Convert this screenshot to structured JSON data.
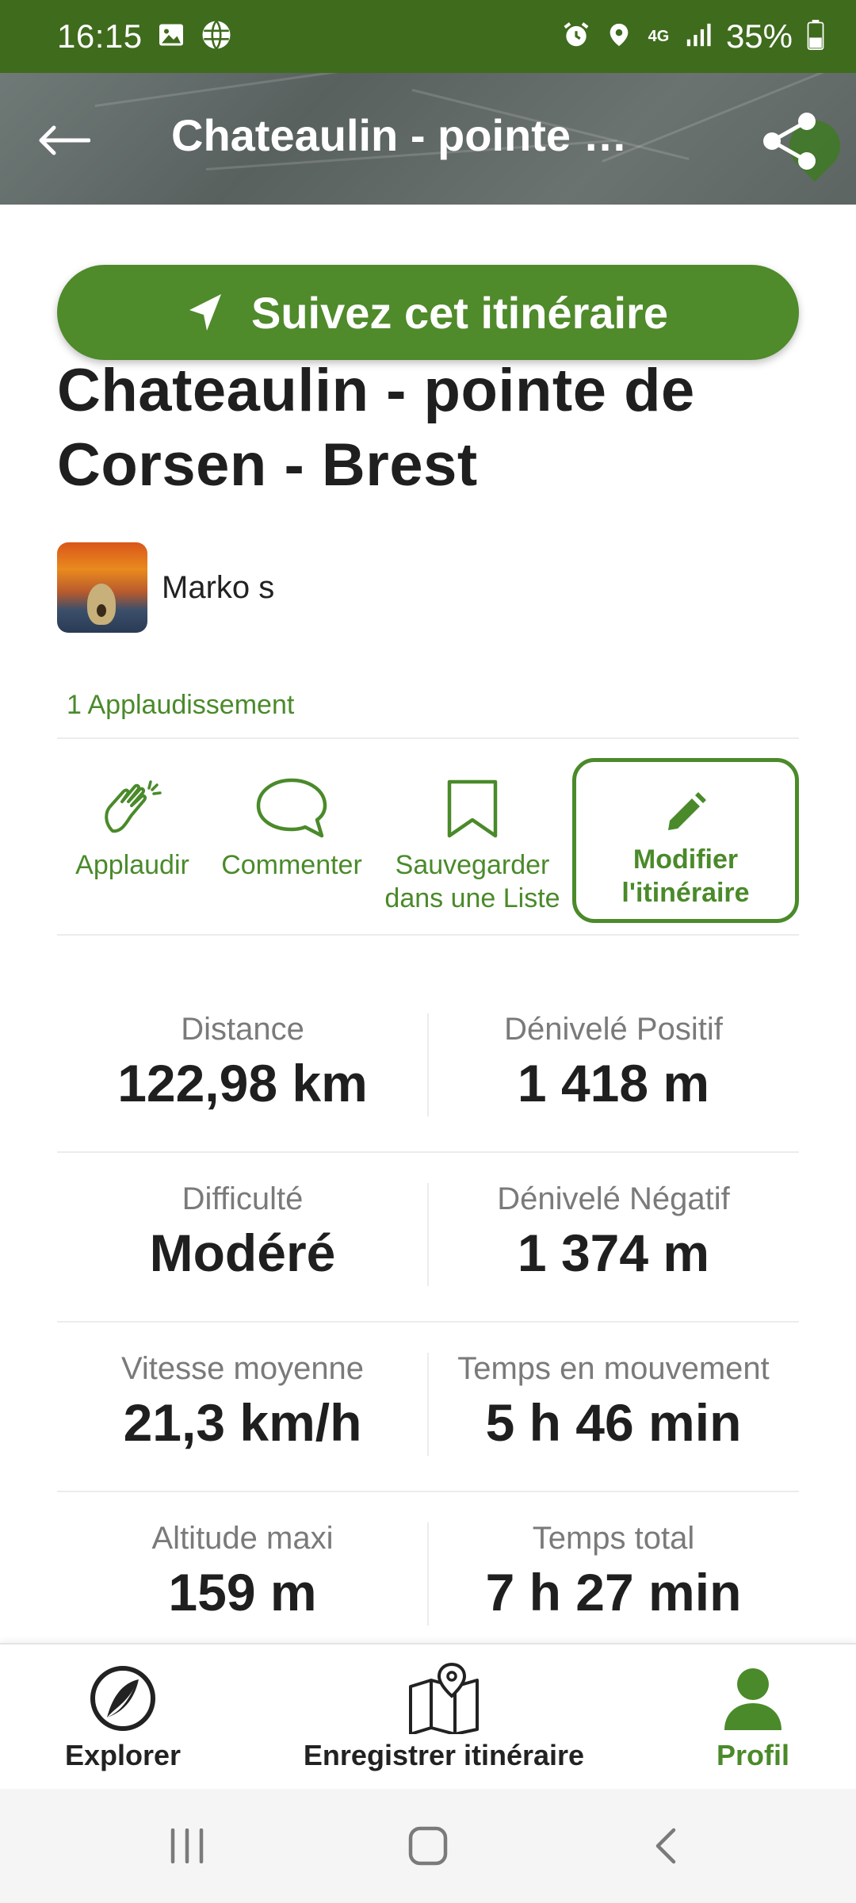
{
  "status_bar": {
    "time": "16:15",
    "network": "4G",
    "battery": "35%",
    "left_icons": [
      "image-icon",
      "globe-icon"
    ],
    "right_icons": [
      "alarm-icon",
      "location-icon",
      "network-4g-icon",
      "signal-icon",
      "battery-icon"
    ]
  },
  "header": {
    "title": "Chateaulin - pointe de Corsen - Brest",
    "back_icon": "arrow-left-icon",
    "share_icon": "share-icon"
  },
  "follow_button": {
    "label": "Suivez cet itinéraire",
    "icon": "navigation-arrow-icon"
  },
  "route": {
    "title": "Chateaulin - pointe de Corsen - Brest",
    "author": "Marko s",
    "applause_count": "1 Applaudissement"
  },
  "actions": {
    "applaud": "Applaudir",
    "comment": "Commenter",
    "save": "Sauvegarder dans une Liste",
    "edit": "Modifier l'itinéraire"
  },
  "stats": [
    {
      "left": {
        "label": "Distance",
        "value": "122,98 km"
      },
      "right": {
        "label": "Dénivelé Positif",
        "value": "1 418 m"
      }
    },
    {
      "left": {
        "label": "Difficulté",
        "value": "Modéré"
      },
      "right": {
        "label": "Dénivelé Négatif",
        "value": "1 374 m"
      }
    },
    {
      "left": {
        "label": "Vitesse moyenne",
        "value": "21,3 km/h"
      },
      "right": {
        "label": "Temps en mouvement",
        "value": "5 h 46 min"
      }
    },
    {
      "left": {
        "label": "Altitude maxi",
        "value": "159 m"
      },
      "right": {
        "label": "Temps total",
        "value": "7 h 27 min"
      }
    }
  ],
  "bottom_nav": {
    "items": [
      {
        "label": "Explorer",
        "icon": "explore-icon",
        "active": false
      },
      {
        "label": "Enregistrer itinéraire",
        "icon": "map-pin-icon",
        "active": false
      },
      {
        "label": "Profil",
        "icon": "profile-icon",
        "active": true
      }
    ]
  },
  "system_nav": [
    "recents-icon",
    "home-icon",
    "back-icon"
  ],
  "colors": {
    "accent": "#4a8a2a",
    "status_bar": "#3f6b1d",
    "button": "#4f8a2b"
  }
}
